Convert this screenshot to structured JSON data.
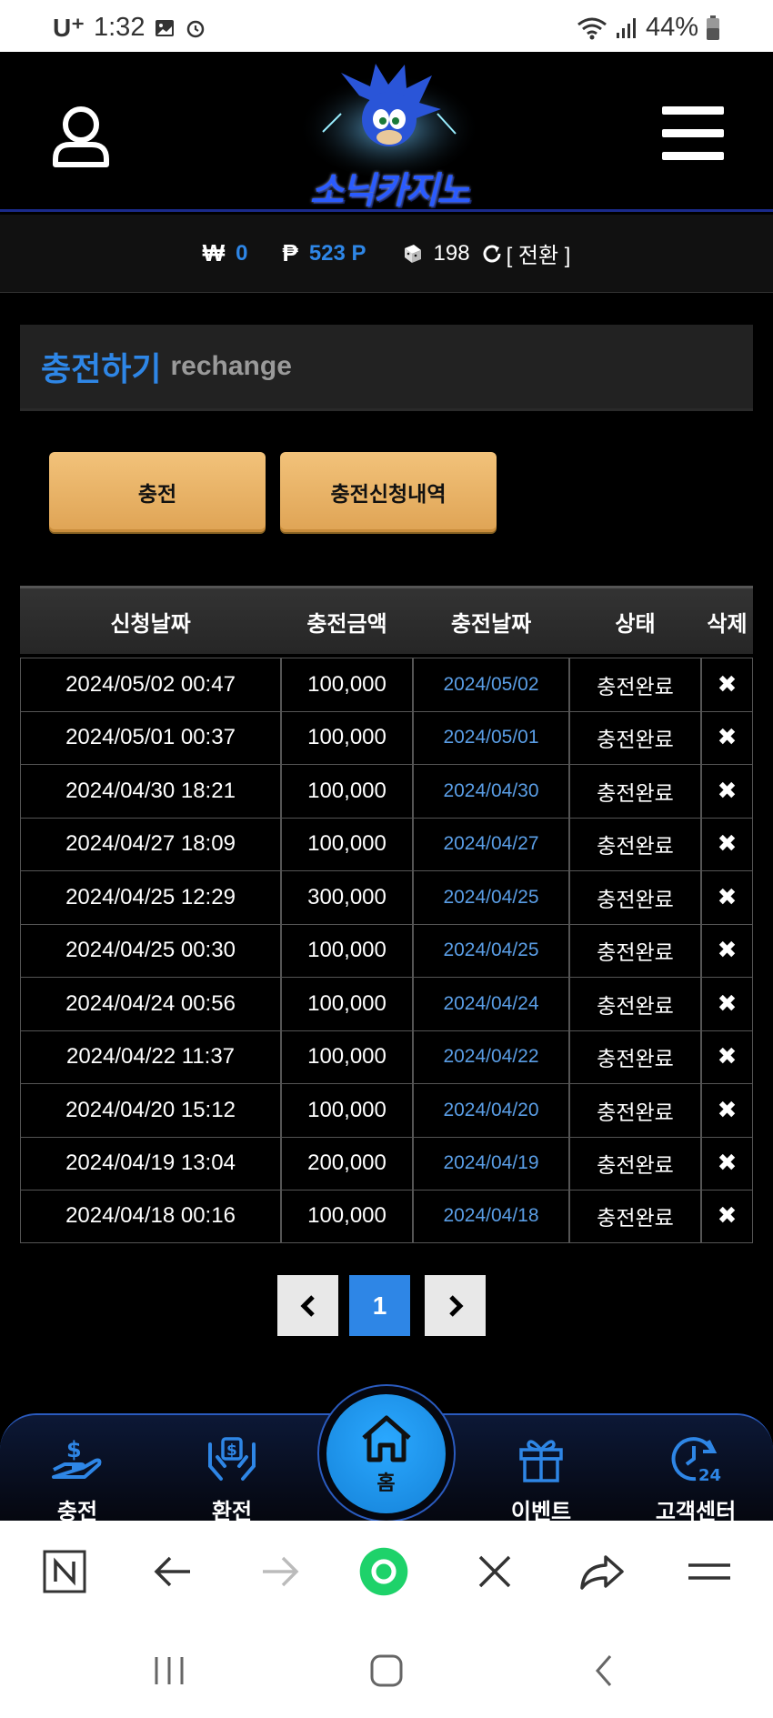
{
  "status_bar": {
    "carrier": "U⁺",
    "time": "1:32",
    "battery": "44%"
  },
  "header": {
    "logo_text": "소닉카지노"
  },
  "balance": {
    "won_symbol": "₩",
    "won_value": "0",
    "point_symbol": "₱",
    "point_value": "523 P",
    "chip_value": "198",
    "convert_label": "[ 전환 ]"
  },
  "section": {
    "title_ko": "충전하기",
    "title_en": "rechange"
  },
  "tabs": [
    {
      "label": "충전"
    },
    {
      "label": "충전신청내역"
    }
  ],
  "table": {
    "headers": [
      "신청날짜",
      "충전금액",
      "충전날짜",
      "상태",
      "삭제"
    ],
    "rows": [
      {
        "request_date": "2024/05/02 00:47",
        "amount": "100,000",
        "charge_date": "2024/05/02",
        "status": "충전완료"
      },
      {
        "request_date": "2024/05/01 00:37",
        "amount": "100,000",
        "charge_date": "2024/05/01",
        "status": "충전완료"
      },
      {
        "request_date": "2024/04/30 18:21",
        "amount": "100,000",
        "charge_date": "2024/04/30",
        "status": "충전완료"
      },
      {
        "request_date": "2024/04/27 18:09",
        "amount": "100,000",
        "charge_date": "2024/04/27",
        "status": "충전완료"
      },
      {
        "request_date": "2024/04/25 12:29",
        "amount": "300,000",
        "charge_date": "2024/04/25",
        "status": "충전완료"
      },
      {
        "request_date": "2024/04/25 00:30",
        "amount": "100,000",
        "charge_date": "2024/04/25",
        "status": "충전완료"
      },
      {
        "request_date": "2024/04/24 00:56",
        "amount": "100,000",
        "charge_date": "2024/04/24",
        "status": "충전완료"
      },
      {
        "request_date": "2024/04/22 11:37",
        "amount": "100,000",
        "charge_date": "2024/04/22",
        "status": "충전완료"
      },
      {
        "request_date": "2024/04/20 15:12",
        "amount": "100,000",
        "charge_date": "2024/04/20",
        "status": "충전완료"
      },
      {
        "request_date": "2024/04/19 13:04",
        "amount": "200,000",
        "charge_date": "2024/04/19",
        "status": "충전완료"
      },
      {
        "request_date": "2024/04/18 00:16",
        "amount": "100,000",
        "charge_date": "2024/04/18",
        "status": "충전완료"
      }
    ],
    "delete_glyph": "✖"
  },
  "pagination": {
    "current": "1"
  },
  "bottom_nav": {
    "deposit": "충전",
    "withdraw": "환전",
    "home": "홈",
    "event": "이벤트",
    "support": "고객센터"
  },
  "colors": {
    "accent_blue": "#2e86e6",
    "gold_button": "#e8b266",
    "nav_dark": "#0c1836"
  },
  "icons": [
    "user-icon",
    "hamburger-menu-icon",
    "refresh-icon",
    "chevron-left-icon",
    "chevron-right-icon",
    "hand-money-icon",
    "hands-dollar-icon",
    "home-icon",
    "gift-icon",
    "clock-24-icon"
  ]
}
